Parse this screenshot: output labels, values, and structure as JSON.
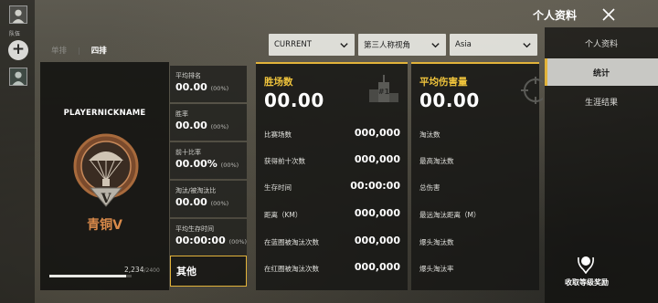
{
  "sidebar": {
    "team_label": "队伍",
    "add_button": "+"
  },
  "modes": {
    "tabs": [
      {
        "label": "单排",
        "active": false
      },
      {
        "label": "四排",
        "active": true
      }
    ],
    "separator": "|"
  },
  "filters": {
    "season": "CURRENT",
    "perspective": "第三人称视角",
    "region": "Asia"
  },
  "profile": {
    "player_name": "PLAYERNICKNAME",
    "rank_name": "青铜V",
    "rank_numeral": "V",
    "xp_value": "2,234",
    "xp_total": "/2400",
    "xp_fraction": 0.93
  },
  "mini_stats": [
    {
      "label": "平均排名",
      "value": "00.00",
      "pct": "(00%)"
    },
    {
      "label": "胜率",
      "value": "00.00",
      "pct": "(00%)"
    },
    {
      "label": "前十比率",
      "value": "00.00%",
      "pct": "(00%)"
    },
    {
      "label": "淘汰/被淘汰比",
      "value": "00.00",
      "pct": "(00%)"
    },
    {
      "label": "平均生存时间",
      "value": "00:00:00",
      "pct": "(00%)"
    }
  ],
  "other_button": "其他",
  "panels": [
    {
      "title": "胜场数",
      "big_value": "00.00",
      "icon": "podium-icon",
      "rows": [
        {
          "label": "比赛场数",
          "value": "000,000"
        },
        {
          "label": "获得前十次数",
          "value": "000,000"
        },
        {
          "label": "生存时间",
          "value": "00:00:00"
        },
        {
          "label": "距离（KM）",
          "value": "000,000"
        },
        {
          "label": "在蓝圈被淘汰次数",
          "value": "000,000"
        },
        {
          "label": "在红圈被淘汰次数",
          "value": "000,000"
        }
      ]
    },
    {
      "title": "平均伤害量",
      "big_value": "00.00",
      "icon": "crosshair-icon",
      "rows": [
        {
          "label": "淘汰数",
          "value": ""
        },
        {
          "label": "最高淘汰数",
          "value": ""
        },
        {
          "label": "总伤害",
          "value": ""
        },
        {
          "label": "最远淘汰距离（M）",
          "value": ""
        },
        {
          "label": "爆头淘汰数",
          "value": ""
        },
        {
          "label": "爆头淘汰率",
          "value": ""
        }
      ]
    }
  ],
  "right_nav": {
    "header": "个人资料",
    "close_icon": "close-icon",
    "items": [
      {
        "label": "个人资料",
        "active": false
      },
      {
        "label": "统计",
        "active": true
      },
      {
        "label": "生涯结果",
        "active": false
      }
    ],
    "reward_label": "收取等级奖励"
  },
  "colors": {
    "accent": "#e2b33a",
    "rank_bronze": "#d98a4a",
    "panel_bg": "#181816"
  }
}
